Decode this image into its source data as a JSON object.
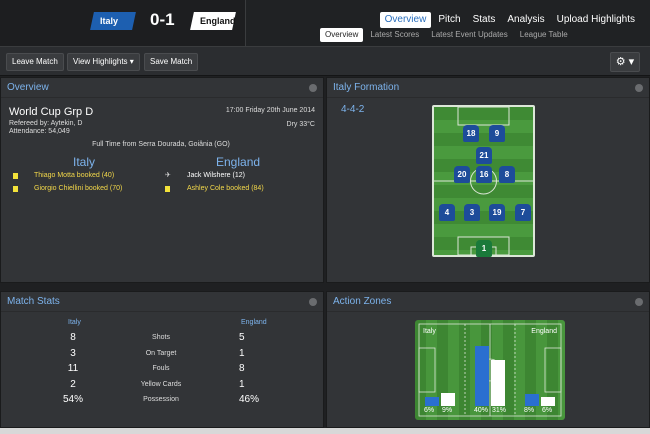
{
  "header": {
    "home_team": "Italy",
    "away_team": "England",
    "score": "0-1",
    "nav": [
      "Overview",
      "Pitch",
      "Stats",
      "Analysis",
      "Upload Highlights"
    ],
    "subnav": [
      "Overview",
      "Latest Scores",
      "Latest Event Updates",
      "League Table"
    ]
  },
  "toolbar": {
    "leave_label": "Leave Match",
    "highlights_label": "View Highlights",
    "highlights_caret": "▾",
    "save_label": "Save Match",
    "gear_glyph": "⚙ ▾"
  },
  "overview": {
    "panel_title": "Overview",
    "competition": "World Cup Grp D",
    "datetime": "17:00 Friday 20th June 2014",
    "referee": "Refereed by: Aytekin, D",
    "weather": "Dry 33°C",
    "attendance": "Attendance: 54,049",
    "fulltime": "Full Time from Serra Dourada, Goiânia (GO)",
    "home_name": "Italy",
    "away_name": "England",
    "home_events": [
      "Thiago Motta booked (40)",
      "Giorgio Chiellini booked (70)"
    ],
    "away_events": [
      "Jack Wilshere (12)",
      "Ashley Cole booked (84)"
    ]
  },
  "formation": {
    "panel_title": "Italy Formation",
    "shape": "4-4-2",
    "players": [
      {
        "num": "18",
        "row": 0,
        "col": 0
      },
      {
        "num": "9",
        "row": 0,
        "col": 1
      },
      {
        "num": "21",
        "row": 1,
        "col": 0
      },
      {
        "num": "20",
        "row": 2,
        "col": 0
      },
      {
        "num": "16",
        "row": 2,
        "col": 1
      },
      {
        "num": "8",
        "row": 2,
        "col": 2
      },
      {
        "num": "4",
        "row": 3,
        "col": 0
      },
      {
        "num": "3",
        "row": 3,
        "col": 1
      },
      {
        "num": "19",
        "row": 3,
        "col": 2
      },
      {
        "num": "7",
        "row": 3,
        "col": 3
      },
      {
        "num": "1",
        "row": 4,
        "col": 0,
        "gk": true
      }
    ]
  },
  "stats": {
    "panel_title": "Match Stats",
    "home_name": "Italy",
    "away_name": "England",
    "rows": [
      {
        "label": "Shots",
        "home": "8",
        "away": "5"
      },
      {
        "label": "On Target",
        "home": "3",
        "away": "1"
      },
      {
        "label": "Fouls",
        "home": "11",
        "away": "8"
      },
      {
        "label": "Yellow Cards",
        "home": "2",
        "away": "1"
      },
      {
        "label": "Possession",
        "home": "54%",
        "away": "46%"
      }
    ]
  },
  "zones": {
    "panel_title": "Action Zones",
    "home_name": "Italy",
    "away_name": "England",
    "zones": [
      {
        "home": "6%",
        "away": "9%",
        "home_frac": 0.06,
        "away_frac": 0.09
      },
      {
        "home": "40%",
        "away": "31%",
        "home_frac": 0.4,
        "away_frac": 0.31
      },
      {
        "home": "8%",
        "away": "6%",
        "home_frac": 0.08,
        "away_frac": 0.06
      }
    ]
  }
}
